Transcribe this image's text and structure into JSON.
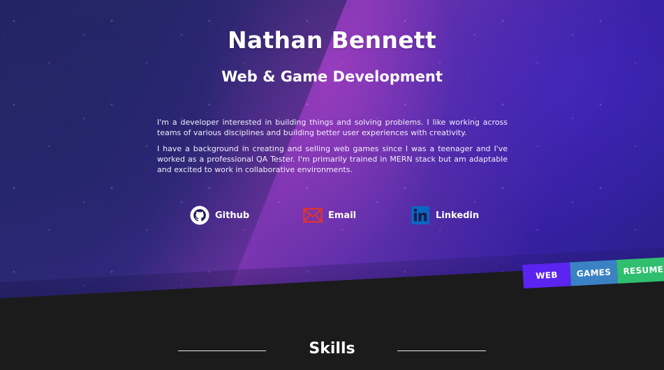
{
  "hero": {
    "name": "Nathan Bennett",
    "tagline": "Web & Game Development",
    "bio": [
      "I'm a developer interested in building things and solving problems. I like working across teams of various disciplines and building better user experiences with creativity.",
      "I have a background in creating and selling web games since I was a teenager and I've worked as a professional QA Tester. I'm primarily trained in MERN stack but am adaptable and excited to work in collaborative environments."
    ]
  },
  "socials": [
    {
      "label": "Github",
      "icon": "github-icon"
    },
    {
      "label": "Email",
      "icon": "mail-icon",
      "color": "#e0352b"
    },
    {
      "label": "Linkedin",
      "icon": "linkedin-icon",
      "color": "#0a66c2"
    }
  ],
  "tabs": [
    {
      "label": "WEB",
      "color": "#5b24f0"
    },
    {
      "label": "GAMES",
      "color": "#3a82c4"
    },
    {
      "label": "RESUME",
      "color": "#2fbf6e"
    }
  ],
  "skills": {
    "title": "Skills"
  },
  "colors": {
    "page_background": "#1b1b1b",
    "hero_purple": "#7a35b0",
    "hero_blue": "#2c2a78"
  }
}
